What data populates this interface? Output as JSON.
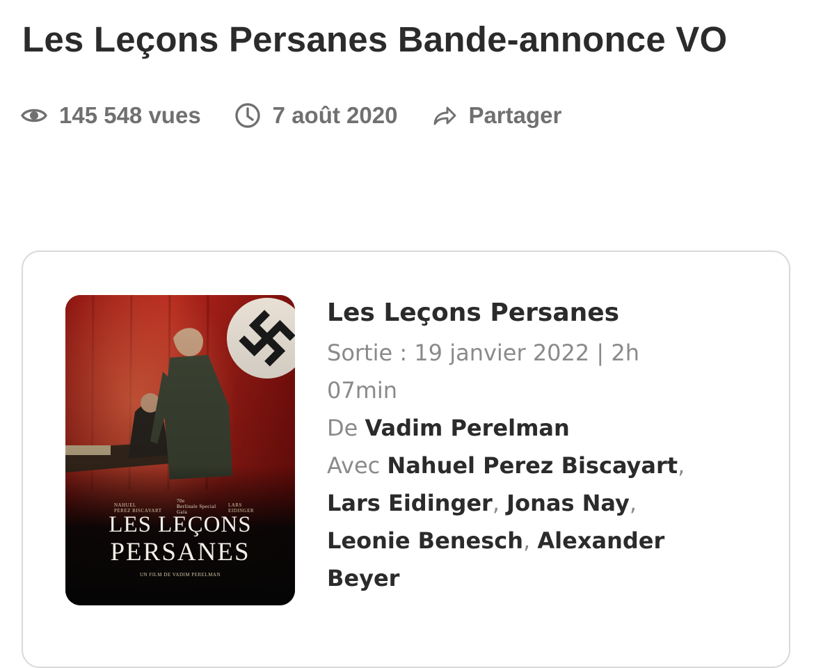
{
  "page": {
    "title": "Les Leçons Persanes Bande-annonce VO"
  },
  "meta": {
    "views": "145 548 vues",
    "date": "7 août 2020",
    "share_label": "Partager",
    "icons": {
      "views": "eye-icon",
      "date": "clock-icon",
      "share": "share-arrow-icon"
    },
    "color": "#707070"
  },
  "movie": {
    "title": "Les Leçons Persanes",
    "release_text": "Sortie : 19 janvier 2022 | 2h 07min",
    "director_prefix": "De",
    "director": "Vadim Perelman",
    "cast_prefix": "Avec",
    "cast": [
      "Nahuel Perez Biscayart",
      "Lars Eidinger",
      "Jonas Nay",
      "Leonie Benesch",
      "Alexander Beyer"
    ],
    "cast_separator": ","
  },
  "poster": {
    "title_line_1": "LES LEÇONS",
    "title_line_2": "PERSANES",
    "actor_left_1": "NAHUEL",
    "actor_left_2": "PEREZ BISCAYART",
    "actor_right_1": "LARS",
    "actor_right_2": "EIDINGER",
    "festival_1": "70e",
    "festival_2": "Berlinale Special",
    "festival_3": "Gala",
    "director_credit": "UN FILM DE VADIM PERELMAN"
  },
  "colors": {
    "title": "#2b2b2b",
    "muted": "#8a8a8a",
    "card_border": "#d9d9d9",
    "poster_red": "#a31d17"
  }
}
